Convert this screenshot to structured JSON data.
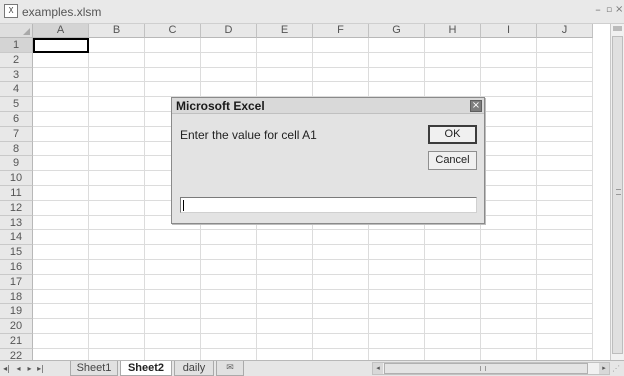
{
  "window": {
    "title": "examples.xlsm",
    "icon": "excel-workbook-icon",
    "controls": {
      "minimize": "–",
      "restore": "▫",
      "close": "×"
    }
  },
  "grid": {
    "corner_icon": "select-all-icon",
    "columns": [
      "A",
      "B",
      "C",
      "D",
      "E",
      "F",
      "G",
      "H",
      "I",
      "J"
    ],
    "rows": [
      "1",
      "2",
      "3",
      "4",
      "5",
      "6",
      "7",
      "8",
      "9",
      "10",
      "11",
      "12",
      "13",
      "14",
      "15",
      "16",
      "17",
      "18",
      "19",
      "20",
      "21",
      "22"
    ],
    "active_cell": "A1"
  },
  "sheet_tabs": {
    "nav_icons": [
      "first-sheet-icon",
      "previous-sheet-icon",
      "next-sheet-icon",
      "last-sheet-icon"
    ],
    "tabs": [
      "Sheet1",
      "Sheet2",
      "daily"
    ],
    "active_tab": "Sheet2",
    "new_sheet_icon": "insert-worksheet-icon"
  },
  "dialog": {
    "title": "Microsoft Excel",
    "prompt": "Enter the value for cell A1",
    "ok_label": "OK",
    "cancel_label": "Cancel",
    "input_value": "",
    "close_icon": "close-icon"
  }
}
